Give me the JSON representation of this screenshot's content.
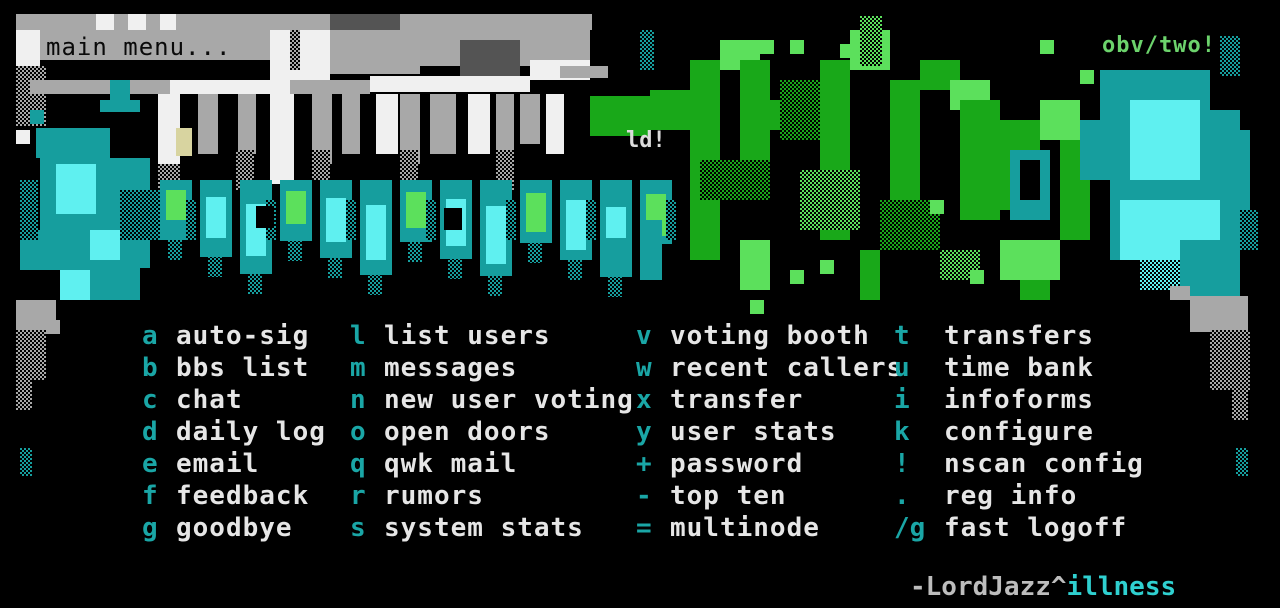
{
  "header": {
    "title": "main menu...",
    "tag": "obv/two!",
    "fragment": "ld!"
  },
  "colors": {
    "background": "#000000",
    "key": "#1aa6a6",
    "label": "#e6e6e6",
    "green": "#19a819",
    "bright_green": "#5ce05c",
    "teal": "#169e9e",
    "cyan": "#5ff0f0",
    "grey": "#a8a8a8",
    "dark_grey": "#545454",
    "white": "#f0f0f0"
  },
  "menu": {
    "columns": [
      [
        {
          "key": "a",
          "label": "auto-sig"
        },
        {
          "key": "b",
          "label": "bbs list"
        },
        {
          "key": "c",
          "label": "chat"
        },
        {
          "key": "d",
          "label": "daily log"
        },
        {
          "key": "e",
          "label": "email"
        },
        {
          "key": "f",
          "label": "feedback"
        },
        {
          "key": "g",
          "label": "goodbye"
        }
      ],
      [
        {
          "key": "l",
          "label": "list users"
        },
        {
          "key": "m",
          "label": "messages"
        },
        {
          "key": "n",
          "label": "new user voting"
        },
        {
          "key": "o",
          "label": "open doors"
        },
        {
          "key": "q",
          "label": "qwk mail"
        },
        {
          "key": "r",
          "label": "rumors"
        },
        {
          "key": "s",
          "label": "system stats"
        }
      ],
      [
        {
          "key": "v",
          "label": "voting booth"
        },
        {
          "key": "w",
          "label": "recent callers"
        },
        {
          "key": "x",
          "label": "transfer"
        },
        {
          "key": "y",
          "label": "user stats"
        },
        {
          "key": "+",
          "label": "password"
        },
        {
          "key": "-",
          "label": "top ten"
        },
        {
          "key": "=",
          "label": "multinode"
        }
      ],
      [
        {
          "key": "t",
          "label": "transfers"
        },
        {
          "key": "u",
          "label": "time bank"
        },
        {
          "key": "i",
          "label": "infoforms"
        },
        {
          "key": "k",
          "label": "configure"
        },
        {
          "key": "!",
          "label": "nscan config"
        },
        {
          "key": ".",
          "label": "reg info"
        },
        {
          "key": "/g",
          "label": "fast logoff"
        }
      ]
    ]
  },
  "signature": {
    "author": "-LordJazz^",
    "group": "illness"
  }
}
